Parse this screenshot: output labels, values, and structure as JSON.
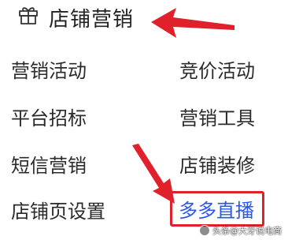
{
  "header": {
    "icon": "gift-icon",
    "title": "店铺营销"
  },
  "menu": {
    "left": [
      {
        "label": "营销活动"
      },
      {
        "label": "平台招标"
      },
      {
        "label": "短信营销"
      },
      {
        "label": "店铺页设置"
      }
    ],
    "right": [
      {
        "label": "竞价活动"
      },
      {
        "label": "营销工具"
      },
      {
        "label": "店铺装修"
      },
      {
        "label": "多多直播",
        "highlighted": true
      }
    ]
  },
  "annotations": {
    "arrow_color": "#e0202a",
    "highlight_border_color": "#e0202a",
    "highlight_text_color": "#2a57e8"
  },
  "watermark": {
    "text": "头条@大牙说电商"
  }
}
